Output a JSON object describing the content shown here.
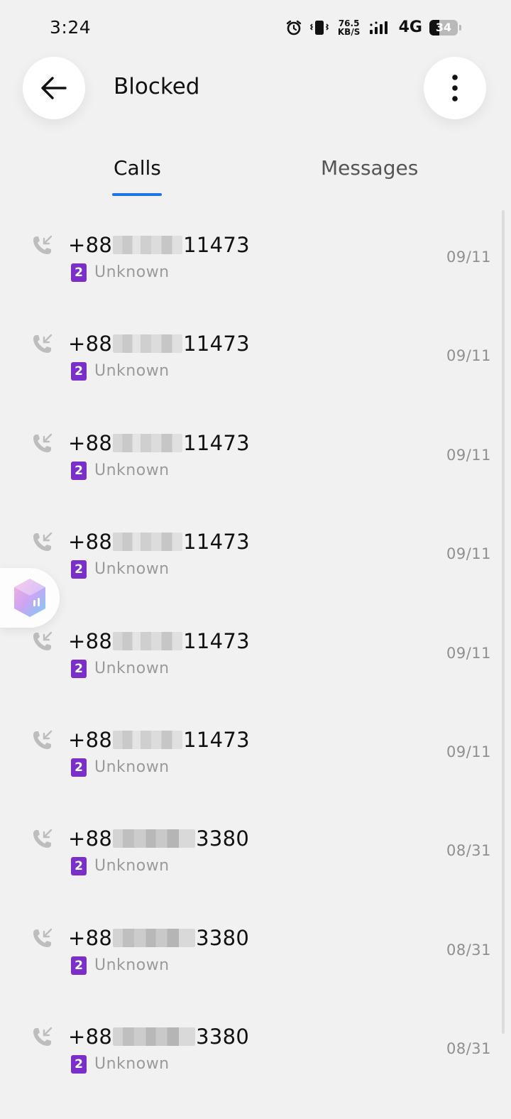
{
  "status_bar": {
    "time": "3:24",
    "speed_value": "76.5",
    "speed_unit": "KB/S",
    "network": "4G",
    "battery": "34",
    "icons": [
      "alarm-icon",
      "vibrate-icon",
      "signal-icon",
      "battery-icon"
    ]
  },
  "header": {
    "title": "Blocked",
    "back_icon": "arrow-left-icon",
    "more_icon": "more-vertical-icon"
  },
  "tabs": [
    {
      "label": "Calls",
      "selected": true
    },
    {
      "label": "Messages",
      "selected": false
    }
  ],
  "calls": [
    {
      "prefix": "+88",
      "suffix": "11473",
      "sim": "2",
      "label": "Unknown",
      "date": "09/11"
    },
    {
      "prefix": "+88",
      "suffix": "11473",
      "sim": "2",
      "label": "Unknown",
      "date": "09/11"
    },
    {
      "prefix": "+88",
      "suffix": "11473",
      "sim": "2",
      "label": "Unknown",
      "date": "09/11"
    },
    {
      "prefix": "+88",
      "suffix": "11473",
      "sim": "2",
      "label": "Unknown",
      "date": "09/11"
    },
    {
      "prefix": "+88",
      "suffix": "11473",
      "sim": "2",
      "label": "Unknown",
      "date": "09/11"
    },
    {
      "prefix": "+88",
      "suffix": "11473",
      "sim": "2",
      "label": "Unknown",
      "date": "09/11"
    },
    {
      "prefix": "+88",
      "suffix": "3380",
      "sim": "2",
      "label": "Unknown",
      "date": "08/31"
    },
    {
      "prefix": "+88",
      "suffix": "3380",
      "sim": "2",
      "label": "Unknown",
      "date": "08/31"
    },
    {
      "prefix": "+88",
      "suffix": "3380",
      "sim": "2",
      "label": "Unknown",
      "date": "08/31"
    }
  ],
  "colors": {
    "accent": "#1f73e8",
    "sim_badge": "#7b2fc9",
    "background": "#f1f1f1"
  }
}
